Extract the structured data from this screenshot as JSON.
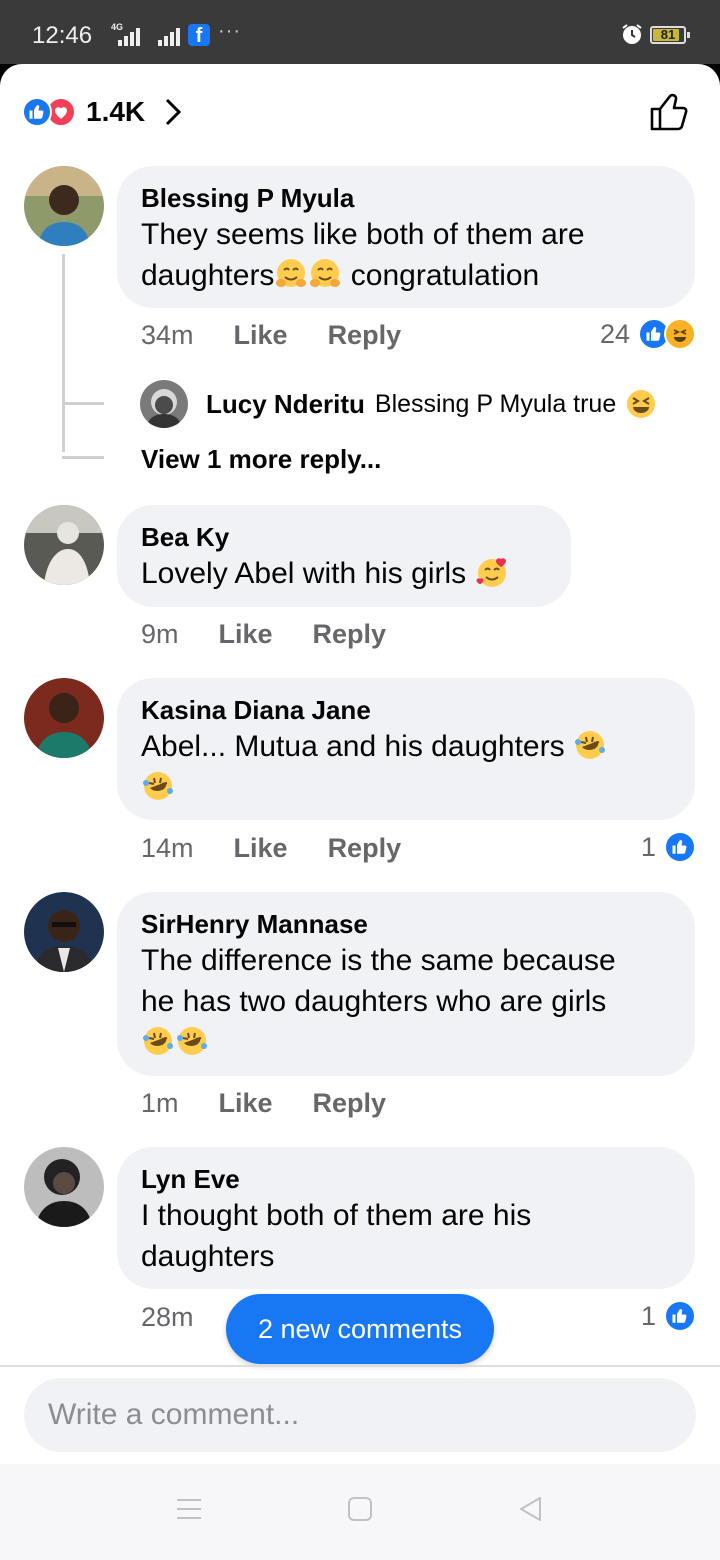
{
  "status_bar": {
    "time": "12:46",
    "network": "4G",
    "battery": "81"
  },
  "header": {
    "reaction_count": "1.4K",
    "icons": [
      "like-icon",
      "love-icon",
      "chevron-right-icon",
      "thumbs-up-outline-icon"
    ]
  },
  "comments": [
    {
      "author": "Blessing P Myula",
      "text_line1": "They seems like both of them are",
      "text_line2a": "daughters",
      "text_line2b": " congratulation",
      "time": "34m",
      "like": "Like",
      "reply": "Reply",
      "reaction_count": "24",
      "reply_preview": {
        "author": "Lucy Nderitu",
        "text": "Blessing P Myula true"
      },
      "view_more": "View 1 more reply..."
    },
    {
      "author": "Bea Ky",
      "text": "Lovely Abel with his girls",
      "time": "9m",
      "like": "Like",
      "reply": "Reply"
    },
    {
      "author": "Kasina Diana Jane",
      "text": "Abel... Mutua and his daughters",
      "time": "14m",
      "like": "Like",
      "reply": "Reply",
      "reaction_count": "1"
    },
    {
      "author": "SirHenry Mannase",
      "text_line1": "The difference is the same because",
      "text_line2": "he has two daughters who are girls",
      "time": "1m",
      "like": "Like",
      "reply": "Reply"
    },
    {
      "author": "Lyn Eve",
      "text_line1": "I thought both of them are his",
      "text_line2": "daughters",
      "time": "28m",
      "reaction_count": "1"
    }
  ],
  "new_comments_pill": "2 new comments",
  "composer": {
    "placeholder": "Write a comment..."
  },
  "nav": [
    "menu-icon",
    "home-square-icon",
    "back-triangle-icon"
  ]
}
